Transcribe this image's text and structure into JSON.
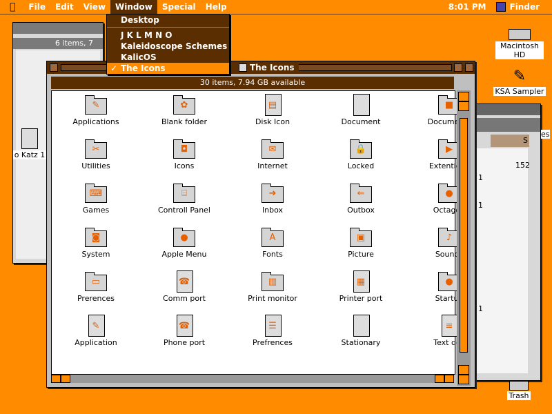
{
  "menubar": {
    "apple_icon": "apple-icon",
    "items": [
      "File",
      "Edit",
      "View",
      "Window",
      "Special",
      "Help"
    ],
    "active": "Window",
    "clock": "8:01 PM",
    "app": "Finder"
  },
  "window_menu": {
    "items": [
      {
        "label": "Desktop"
      },
      {
        "label": "J K L M N O"
      },
      {
        "label": "Kaleidoscope Schemes"
      },
      {
        "label": "KalicOS"
      },
      {
        "label": "The Icons",
        "checked": true
      }
    ]
  },
  "back_left_window": {
    "info": "6 items, 7"
  },
  "back_right_window": {
    "col_label": "S",
    "values": [
      "152",
      "1",
      "1",
      "1"
    ]
  },
  "desktop": {
    "icons": [
      {
        "label": "Macintosh HD",
        "icon": "hard-drive-icon"
      },
      {
        "label": "KSA Sampler",
        "icon": "application-icon"
      },
      {
        "label": "Trash",
        "icon": "trash-icon"
      },
      {
        "label": "o Katz 1",
        "icon": "document-icon"
      }
    ],
    "edge_text": "es"
  },
  "main_window": {
    "title": "The Icons",
    "status": "30 items, 7.94 GB available",
    "icons": [
      {
        "label": "Applications",
        "icon": "applications-folder-icon"
      },
      {
        "label": "Blank folder",
        "icon": "blank-folder-icon"
      },
      {
        "label": "Disk Icon",
        "icon": "floppy-disk-icon"
      },
      {
        "label": "Document",
        "icon": "document-icon"
      },
      {
        "label": "Documents",
        "icon": "documents-folder-icon"
      },
      {
        "label": "Utilities",
        "icon": "utilities-folder-icon"
      },
      {
        "label": "Icons",
        "icon": "icons-folder-icon"
      },
      {
        "label": "Internet",
        "icon": "internet-folder-icon"
      },
      {
        "label": "Locked",
        "icon": "locked-folder-icon"
      },
      {
        "label": "Extentions",
        "icon": "extensions-folder-icon"
      },
      {
        "label": "Games",
        "icon": "games-folder-icon"
      },
      {
        "label": "Controll Panel",
        "icon": "control-panel-folder-icon"
      },
      {
        "label": "Inbox",
        "icon": "inbox-folder-icon"
      },
      {
        "label": "Outbox",
        "icon": "outbox-folder-icon"
      },
      {
        "label": "Octagon",
        "icon": "octagon-folder-icon"
      },
      {
        "label": "System",
        "icon": "system-folder-icon"
      },
      {
        "label": "Apple Menu",
        "icon": "apple-menu-folder-icon"
      },
      {
        "label": "Fonts",
        "icon": "fonts-folder-icon"
      },
      {
        "label": "Picture",
        "icon": "picture-folder-icon"
      },
      {
        "label": "Sounds",
        "icon": "sounds-folder-icon"
      },
      {
        "label": "Prerences",
        "icon": "preferences-folder-icon"
      },
      {
        "label": "Comm port",
        "icon": "comm-port-icon"
      },
      {
        "label": "Print monitor",
        "icon": "print-monitor-icon"
      },
      {
        "label": "Printer port",
        "icon": "printer-port-icon"
      },
      {
        "label": "Startup",
        "icon": "startup-folder-icon"
      },
      {
        "label": "Application",
        "icon": "application-icon"
      },
      {
        "label": "Phone port",
        "icon": "phone-port-icon"
      },
      {
        "label": "Prefrences",
        "icon": "preferences-file-icon"
      },
      {
        "label": "Stationary",
        "icon": "stationery-icon"
      },
      {
        "label": "Text doc",
        "icon": "text-document-icon"
      }
    ]
  },
  "colors": {
    "desktop": "#ff8c00",
    "accent_dark": "#5a2e00"
  }
}
